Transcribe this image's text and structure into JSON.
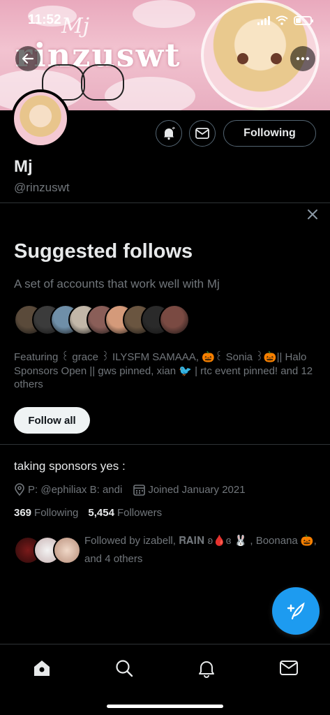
{
  "status_bar": {
    "time": "11:52"
  },
  "banner": {
    "brand_text": "rinzuswt",
    "brand_small": "Mj"
  },
  "profile": {
    "name": "Mj",
    "handle": "@rinzuswt",
    "following_button": "Following"
  },
  "suggested": {
    "title": "Suggested follows",
    "subtitle": "A set of accounts that work well with Mj",
    "featuring": "Featuring ꒰ grace ꒱ ILYSFM SAMAAA, 🎃꒰ Sonia ꒱🎃|| Halo Sponsors Open || gws pinned, xian 🐦 | rtc event pinned! and 12 others",
    "follow_all_label": "Follow all",
    "facepile_colors": [
      "#5a4a3a",
      "#3b3b3b",
      "#6f8fa8",
      "#c2b7a8",
      "#8a5e58",
      "#d49a7a",
      "#6a5540",
      "#2a2a2a",
      "#7a4a42"
    ]
  },
  "bio": {
    "text": "taking sponsors yes :",
    "location": "P: @ephiliax B: andi",
    "joined": "Joined January 2021",
    "following_count": "369",
    "following_label": "Following",
    "followers_count": "5,454",
    "followers_label": "Followers",
    "followed_by": "Followed by izabell, 𝐑𝐀𝐈𝐍 ʚ🩸ɞ 🐰 , Boonana 🎃, and 4 others"
  },
  "colors": {
    "accent": "#1d9bf0",
    "background": "#000000",
    "secondary_text": "#71767b",
    "divider": "#2f3336"
  },
  "icons": [
    "back-arrow-icon",
    "more-icon",
    "bell-icon",
    "mail-icon",
    "close-icon",
    "location-icon",
    "calendar-icon",
    "compose-icon",
    "home-icon",
    "search-icon",
    "notifications-icon",
    "messages-icon"
  ]
}
